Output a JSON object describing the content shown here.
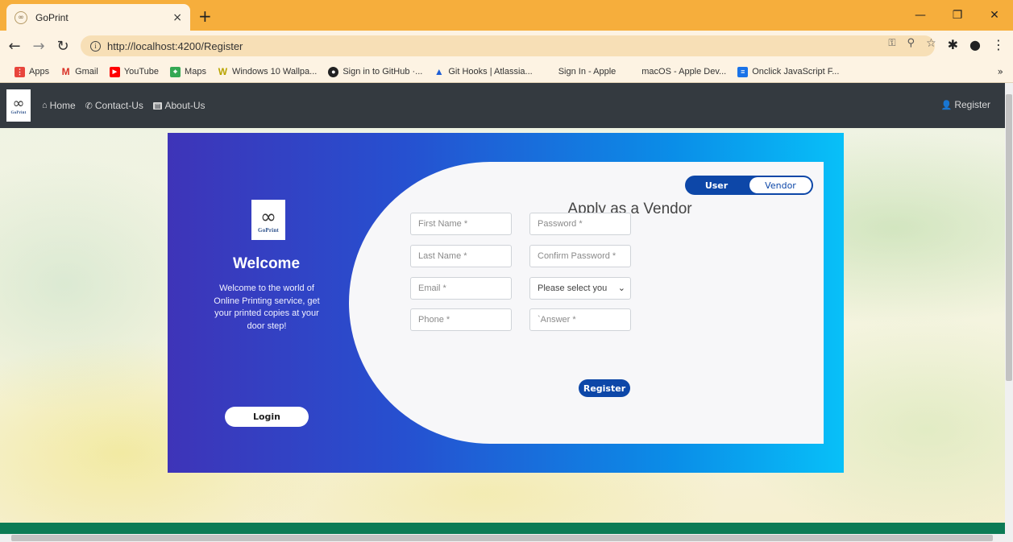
{
  "browser": {
    "tab_title": "GoPrint",
    "tab_close": "×",
    "new_tab": "+",
    "url": "http://localhost:4200/Register",
    "bookmarks": [
      {
        "label": "Apps",
        "icon": "apps-grid-icon",
        "color": "#e8453c"
      },
      {
        "label": "Gmail",
        "icon": "gmail-icon",
        "color": "#d93025"
      },
      {
        "label": "YouTube",
        "icon": "youtube-icon",
        "color": "#ff0000"
      },
      {
        "label": "Maps",
        "icon": "maps-icon",
        "color": "#34a853"
      },
      {
        "label": "Windows 10 Wallpa...",
        "icon": "windows-wallpaper-icon",
        "color": "#b8a400"
      },
      {
        "label": "Sign in to GitHub ·...",
        "icon": "github-icon",
        "color": "#222222"
      },
      {
        "label": "Git Hooks | Atlassia...",
        "icon": "atlassian-icon",
        "color": "#1f5fd6"
      },
      {
        "label": "Sign In - Apple",
        "icon": "apple-icon",
        "color": "#333333"
      },
      {
        "label": "macOS - Apple Dev...",
        "icon": "apple-icon",
        "color": "#777777"
      },
      {
        "label": "Onclick JavaScript F...",
        "icon": "document-icon",
        "color": "#1a73e8"
      }
    ],
    "more": "»"
  },
  "navbar": {
    "brand_word": "GoPrint",
    "home": "Home",
    "contact": "Contact-Us",
    "about": "About-Us",
    "register": "Register"
  },
  "welcome": {
    "logo_word": "GoPrint",
    "title": "Welcome",
    "text": "Welcome to the world of Online Printing service, get your printed copies at your door step!",
    "login_label": "Login"
  },
  "form": {
    "toggle_user": "User",
    "toggle_vendor": "Vendor",
    "title": "Apply as a Vendor",
    "first_name_placeholder": "First Name *",
    "last_name_placeholder": "Last Name *",
    "email_placeholder": "Email *",
    "phone_placeholder": "Phone *",
    "password_placeholder": "Password *",
    "confirm_password_placeholder": "Confirm Password *",
    "security_question_selected": "Please select you",
    "answer_placeholder": "`Answer *",
    "register_label": "Register"
  },
  "colors": {
    "tabbar": "#f6ae3c",
    "navbar": "#343a40",
    "gradient_start": "#3e34b8",
    "gradient_end": "#08c0f8",
    "primary_button": "#0d47a8",
    "footer": "#0c7b55"
  }
}
